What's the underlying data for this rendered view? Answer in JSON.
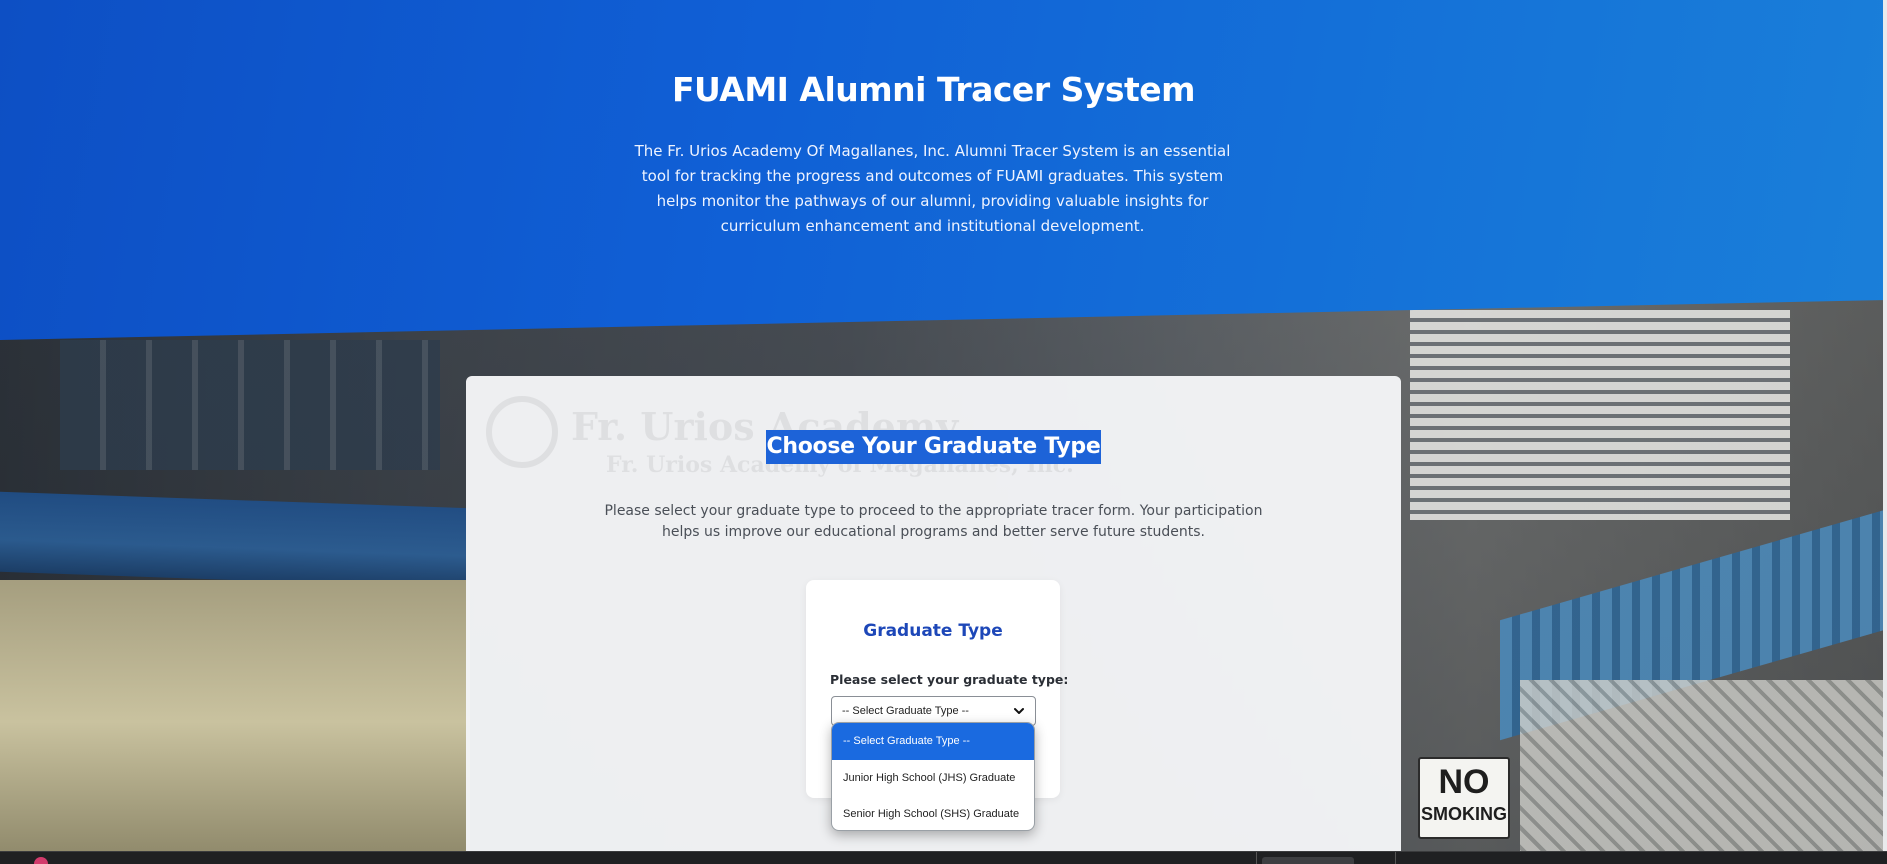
{
  "hero": {
    "title": "FUAMI Alumni Tracer System",
    "description": "The Fr. Urios Academy Of Magallanes, Inc. Alumni Tracer System is an essential tool for tracking the progress and outcomes of FUAMI graduates. This system helps monitor the pathways of our alumni, providing valuable insights for curriculum enhancement and institutional development."
  },
  "card": {
    "title": "Choose Your Graduate Type",
    "description": "Please select your graduate type to proceed to the appropriate tracer form. Your participation helps us improve our educational programs and better serve future students.",
    "watermark": {
      "line1": "Fr. Urios Academy",
      "line2": "Fr. Urios Academy of Magallanes, Inc."
    }
  },
  "graduate_type": {
    "title": "Graduate Type",
    "label": "Please select your graduate type:",
    "selected_value": "-- Select Graduate Type --",
    "options": [
      "-- Select Graduate Type --",
      "Junior High School (JHS) Graduate",
      "Senior High School (SHS) Graduate"
    ],
    "selected_index": 0
  },
  "background": {
    "sign_line1": "NO",
    "sign_line2": "SMOKING"
  },
  "colors": {
    "hero_blue": "#1060d6",
    "accent_blue": "#1d47b8",
    "highlight_blue": "#1d63d8",
    "option_selected": "#1a6ae0"
  },
  "icons": {
    "select_arrow": "chevron-down-icon"
  }
}
